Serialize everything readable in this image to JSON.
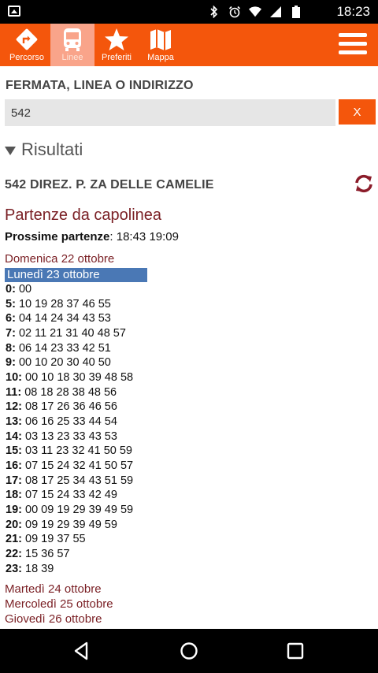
{
  "status_bar": {
    "time": "18:23"
  },
  "tabs": [
    {
      "id": "percorso",
      "label": "Percorso",
      "icon": "route-sign-icon",
      "active": false
    },
    {
      "id": "linee",
      "label": "Linee",
      "icon": "bus-icon",
      "active": true
    },
    {
      "id": "preferiti",
      "label": "Preferiti",
      "icon": "star-icon",
      "active": false
    },
    {
      "id": "mappa",
      "label": "Mappa",
      "icon": "map-icon",
      "active": false
    }
  ],
  "search": {
    "label": "FERMATA, LINEA O INDIRIZZO",
    "value": "542",
    "clear_label": "X"
  },
  "results": {
    "header": "Risultati"
  },
  "line": {
    "title": "542 DIREZ. P. ZA DELLE CAMELIE"
  },
  "departures": {
    "heading": "Partenze da capolinea",
    "next_label": "Prossime partenze",
    "next_times": "18:43 19:09"
  },
  "days_before": [
    "Domenica 22 ottobre"
  ],
  "selected_day": "Lunedì 23 ottobre",
  "schedule": [
    {
      "hour": "0:",
      "minutes": "00"
    },
    {
      "hour": "5:",
      "minutes": "10 19 28 37 46 55"
    },
    {
      "hour": "6:",
      "minutes": "04 14 24 34 43 53"
    },
    {
      "hour": "7:",
      "minutes": "02 11 21 31 40 48 57"
    },
    {
      "hour": "8:",
      "minutes": "06 14 23 33 42 51"
    },
    {
      "hour": "9:",
      "minutes": "00 10 20 30 40 50"
    },
    {
      "hour": "10:",
      "minutes": "00 10 18 30 39 48 58"
    },
    {
      "hour": "11:",
      "minutes": "08 18 28 38 48 56"
    },
    {
      "hour": "12:",
      "minutes": "08 17 26 36 46 56"
    },
    {
      "hour": "13:",
      "minutes": "06 16 25 33 44 54"
    },
    {
      "hour": "14:",
      "minutes": "03 13 23 33 43 53"
    },
    {
      "hour": "15:",
      "minutes": "03 11 23 32 41 50 59"
    },
    {
      "hour": "16:",
      "minutes": "07 15 24 32 41 50 57"
    },
    {
      "hour": "17:",
      "minutes": "08 17 25 34 43 51 59"
    },
    {
      "hour": "18:",
      "minutes": "07 15 24 33 42 49"
    },
    {
      "hour": "19:",
      "minutes": "00 09 19 29 39 49 59"
    },
    {
      "hour": "20:",
      "minutes": "09 19 29 39 49 59"
    },
    {
      "hour": "21:",
      "minutes": "09 19 37 55"
    },
    {
      "hour": "22:",
      "minutes": "15 36 57"
    },
    {
      "hour": "23:",
      "minutes": "18 39"
    }
  ],
  "days_after": [
    "Martedì 24 ottobre",
    "Mercoledì 25 ottobre",
    "Giovedì 26 ottobre"
  ],
  "colors": {
    "accent": "#f4560c",
    "active_tab": "#f9a48a",
    "day_link": "#7a1f24",
    "selected_day": "#4a78b5",
    "refresh": "#8b1c2a"
  }
}
